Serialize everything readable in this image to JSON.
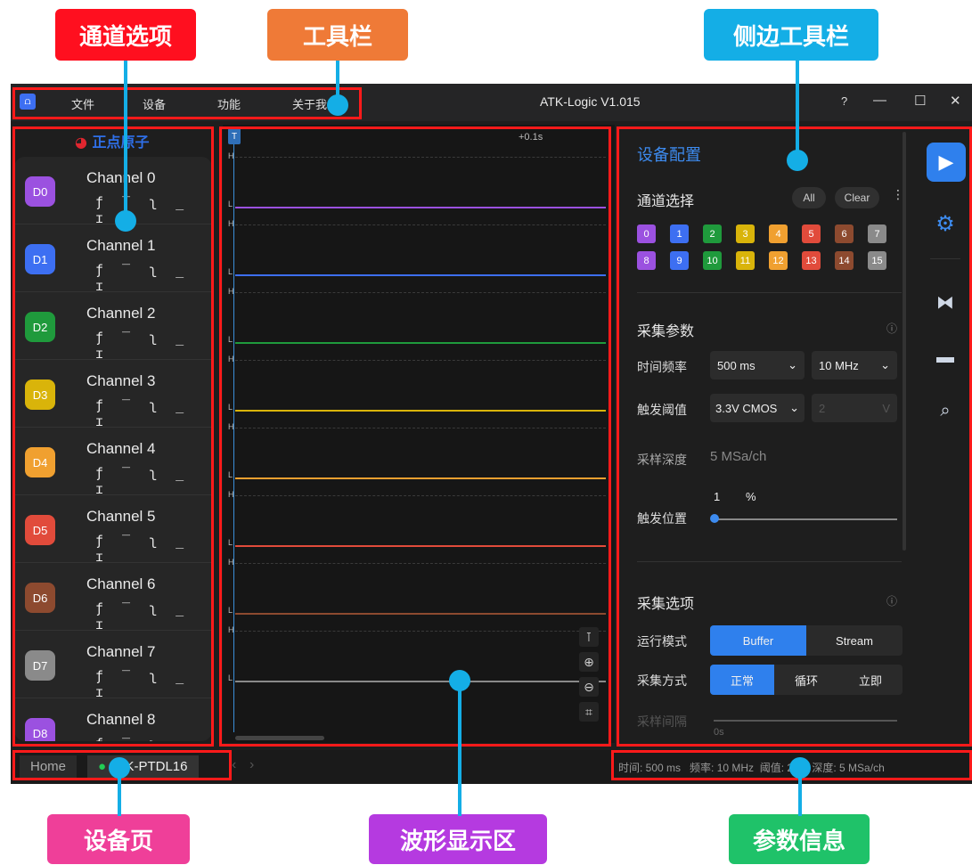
{
  "annotations": {
    "channel_options": "通道选项",
    "toolbar": "工具栏",
    "side_toolbar": "侧边工具栏",
    "device_page": "设备页",
    "waveform_area": "波形显示区",
    "param_info": "参数信息"
  },
  "app": {
    "title": "ATK-Logic  V1.015",
    "logo_icon": "app-logo-icon",
    "menu": [
      "文件",
      "设备",
      "功能",
      "关于我"
    ],
    "window_buttons": [
      "?",
      "—",
      "☐",
      "✕"
    ]
  },
  "brand": {
    "logo_text": "正点原子"
  },
  "channels": [
    {
      "badge": "D0",
      "name": "Channel 0",
      "color": "#9b51e0"
    },
    {
      "badge": "D1",
      "name": "Channel 1",
      "color": "#3d6ff2"
    },
    {
      "badge": "D2",
      "name": "Channel 2",
      "color": "#1f9a3c"
    },
    {
      "badge": "D3",
      "name": "Channel 3",
      "color": "#d9b40a"
    },
    {
      "badge": "D4",
      "name": "Channel 4",
      "color": "#f0a030"
    },
    {
      "badge": "D5",
      "name": "Channel 5",
      "color": "#e14b3b"
    },
    {
      "badge": "D6",
      "name": "Channel 6",
      "color": "#8d4a2f"
    },
    {
      "badge": "D7",
      "name": "Channel 7",
      "color": "#8a8a8a"
    },
    {
      "badge": "D8",
      "name": "Channel 8",
      "color": "#9b51e0"
    }
  ],
  "trigger_icons": "ƒ ‾ ʅ _ ɪ",
  "waveform": {
    "trigger_marker": "T",
    "time_marker": "+0.1s",
    "high_label": "H",
    "low_label": "L"
  },
  "config": {
    "title": "设备配置",
    "channel_select": {
      "label": "通道选择",
      "all_btn": "All",
      "clear_btn": "Clear",
      "chips": [
        "0",
        "1",
        "2",
        "3",
        "4",
        "5",
        "6",
        "7",
        "8",
        "9",
        "10",
        "11",
        "12",
        "13",
        "14",
        "15"
      ],
      "chip_colors": [
        "#9b51e0",
        "#3d6ff2",
        "#1f9a3c",
        "#d9b40a",
        "#f0a030",
        "#e14b3b",
        "#8d4a2f",
        "#8a8a8a",
        "#9b51e0",
        "#3d6ff2",
        "#1f9a3c",
        "#d9b40a",
        "#f0a030",
        "#e14b3b",
        "#8d4a2f",
        "#8a8a8a"
      ]
    },
    "acq_params": {
      "label": "采集参数",
      "time_freq_label": "时间频率",
      "time_value": "500 ms",
      "freq_value": "10 MHz",
      "trigger_threshold_label": "触发阈值",
      "threshold_value": "3.3V CMOS",
      "custom_voltage": "2",
      "voltage_unit": "V",
      "depth_label": "采样深度",
      "depth_value": "5 MSa/ch",
      "trigger_pos_label": "触发位置",
      "trigger_pos_value": "1",
      "trigger_pos_unit": "%"
    },
    "acq_options": {
      "label": "采集选项",
      "run_mode_label": "运行模式",
      "run_modes": [
        "Buffer",
        "Stream"
      ],
      "acq_method_label": "采集方式",
      "acq_methods": [
        "正常",
        "循环",
        "立即"
      ],
      "interval_label": "采样间隔",
      "interval_value": "0s"
    }
  },
  "right_toolbar": [
    "play-icon",
    "gear-icon",
    "decode-icon",
    "measure-icon",
    "search-list-icon"
  ],
  "statusbar": {
    "home_tab": "Home",
    "device_tab": "ATK-PTDL16",
    "info": "时间: 500 ms   频率: 10 MHz  阈值: 2 V   深度: 5 MSa/ch"
  }
}
